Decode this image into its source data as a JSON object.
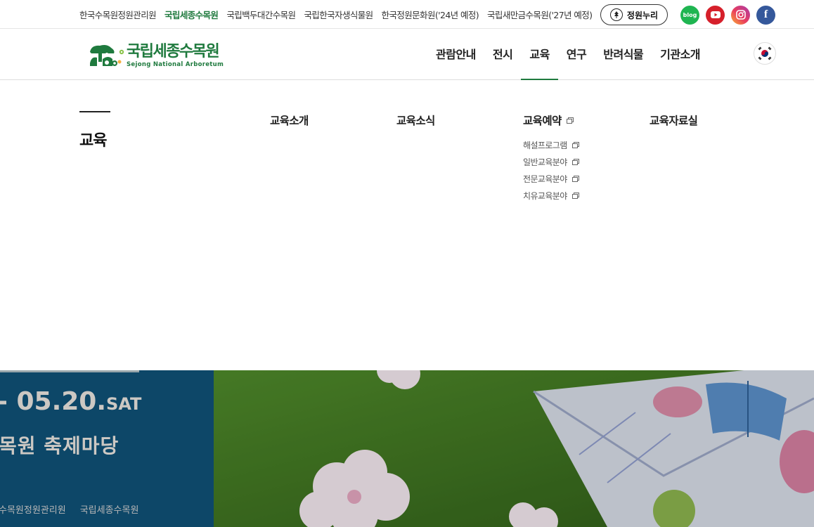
{
  "family_sites": [
    {
      "label": "한국수목원정원관리원",
      "active": false
    },
    {
      "label": "국립세종수목원",
      "active": true
    },
    {
      "label": "국립백두대간수목원",
      "active": false
    },
    {
      "label": "국립한국자생식물원",
      "active": false
    },
    {
      "label": "한국정원문화원('24년 예정)",
      "active": false
    },
    {
      "label": "국립새만금수목원('27년 예정)",
      "active": false
    }
  ],
  "garden_button": {
    "label": "정원누리",
    "icon": "garden-nuri-icon"
  },
  "sns": [
    {
      "name": "blog",
      "label": "blog",
      "color": "#1fb551"
    },
    {
      "name": "youtube",
      "color": "#d6202b"
    },
    {
      "name": "instagram",
      "color": "#c13584"
    },
    {
      "name": "facebook",
      "label": "f",
      "color": "#35589b"
    }
  ],
  "logo": {
    "ko": "국립세종수목원",
    "en": "Sejong National Arboretum"
  },
  "gnb": [
    {
      "label": "관람안내",
      "active": false
    },
    {
      "label": "전시",
      "active": false
    },
    {
      "label": "교육",
      "active": true
    },
    {
      "label": "연구",
      "active": false
    },
    {
      "label": "반려식물",
      "active": false
    },
    {
      "label": "기관소개",
      "active": false
    }
  ],
  "language": {
    "icon": "korea-flag-icon"
  },
  "mega_menu": {
    "title": "교육",
    "columns": [
      {
        "head": "교육소개",
        "external": false,
        "items": []
      },
      {
        "head": "교육소식",
        "external": false,
        "items": []
      },
      {
        "head": "교육예약",
        "external": true,
        "items": [
          "해설프로그램",
          "일반교육분야",
          "전문교육분야",
          "치유교육분야"
        ]
      },
      {
        "head": "교육자료실",
        "external": false,
        "items": []
      }
    ]
  },
  "banner": {
    "date_num": "- 05.20.",
    "date_day": "SAT",
    "festival": "목원 축제마당",
    "org1": "수목원정원관리원",
    "org2": "국립세종수목원"
  },
  "colors": {
    "brand_green": "#1f7a3e",
    "brand_orange": "#d3762d",
    "banner_blue": "#0f5177"
  }
}
